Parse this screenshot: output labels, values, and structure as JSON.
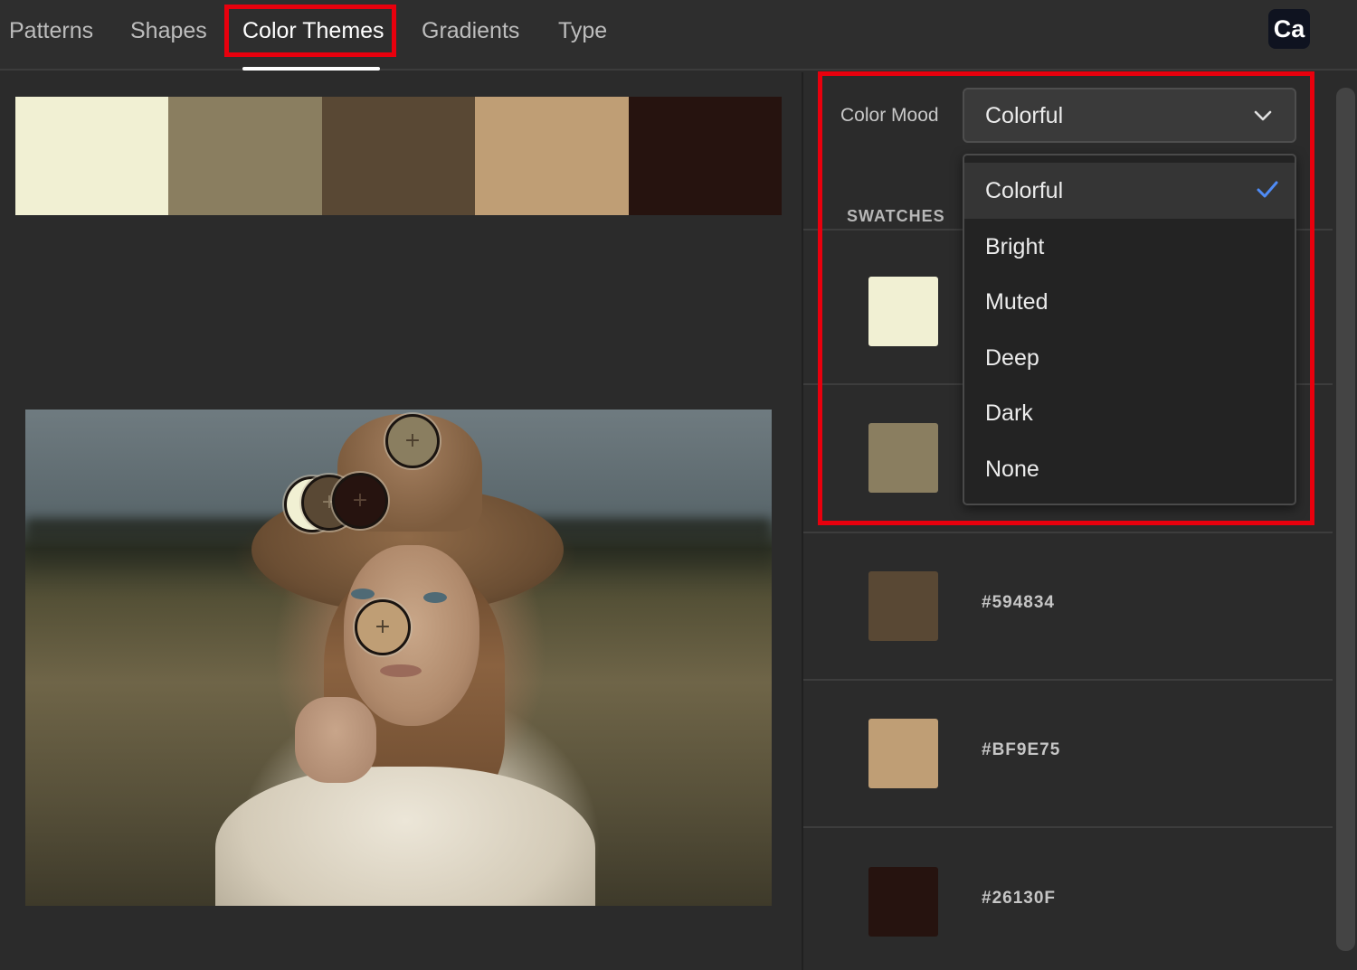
{
  "tabs": [
    {
      "label": "Patterns",
      "active": false
    },
    {
      "label": "Shapes",
      "active": false
    },
    {
      "label": "Color Themes",
      "active": true
    },
    {
      "label": "Gradients",
      "active": false
    },
    {
      "label": "Type",
      "active": false
    }
  ],
  "app_badge": "Ca",
  "palette": [
    "#F1F0D3",
    "#8A7E60",
    "#594834",
    "#BF9E75",
    "#26130F"
  ],
  "color_mood": {
    "label": "Color Mood",
    "selected": "Colorful",
    "options": [
      "Colorful",
      "Bright",
      "Muted",
      "Deep",
      "Dark",
      "None"
    ]
  },
  "swatches": {
    "heading": "SWATCHES",
    "items": [
      {
        "color": "#F1F0D3",
        "hex": ""
      },
      {
        "color": "#8A7E60",
        "hex": ""
      },
      {
        "color": "#594834",
        "hex": "#594834"
      },
      {
        "color": "#BF9E75",
        "hex": "#BF9E75"
      },
      {
        "color": "#26130F",
        "hex": "#26130F"
      }
    ]
  },
  "icons": {
    "dropdown": "chevron-down-icon",
    "selected_option": "checkmark-icon",
    "picker": "plus-icon"
  },
  "colors": {
    "highlight": "#E8000D",
    "check": "#4F8BF5"
  }
}
